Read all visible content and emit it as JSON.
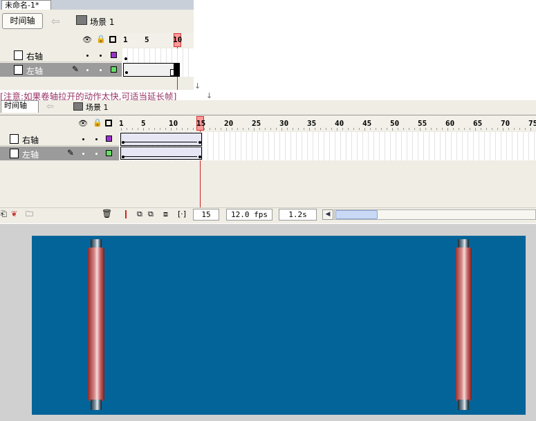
{
  "top_window": {
    "doc_tab": "未命名-1*",
    "timeline_button": "时间轴",
    "scene_label": "场景 1",
    "ruler_numbers": [
      "1",
      "5",
      "10"
    ],
    "layers": [
      {
        "name": "右轴",
        "color": "#9933cc"
      },
      {
        "name": "左轴",
        "color": "#66dd66"
      }
    ]
  },
  "note": {
    "text": "[注意:如果卷轴拉开的动作太快,可适当延长帧]",
    "arrow": "↓"
  },
  "bottom_window": {
    "timeline_tab": "时间轴",
    "scene_label": "场景 1",
    "ruler_numbers": [
      "1",
      "5",
      "10",
      "15",
      "20",
      "25",
      "30",
      "35",
      "40",
      "45",
      "50",
      "55",
      "60",
      "65",
      "70",
      "75"
    ],
    "layers": [
      {
        "name": "右轴",
        "color": "#9933cc"
      },
      {
        "name": "左轴",
        "color": "#66dd66"
      }
    ],
    "status": {
      "current_frame": "15",
      "fps": "12.0 fps",
      "elapsed": "1.2s"
    }
  },
  "icons": {
    "eye": "eye-icon",
    "lock": "lock-icon",
    "outline": "outline-icon",
    "pencil": "pencil-icon",
    "trash": "trash-icon",
    "scene": "scene-icon",
    "back": "back-arrow-icon"
  },
  "colors": {
    "stage": "#03649a",
    "roller": "#c76565",
    "note_text": "#993366",
    "playhead": "#ff9a9a"
  }
}
